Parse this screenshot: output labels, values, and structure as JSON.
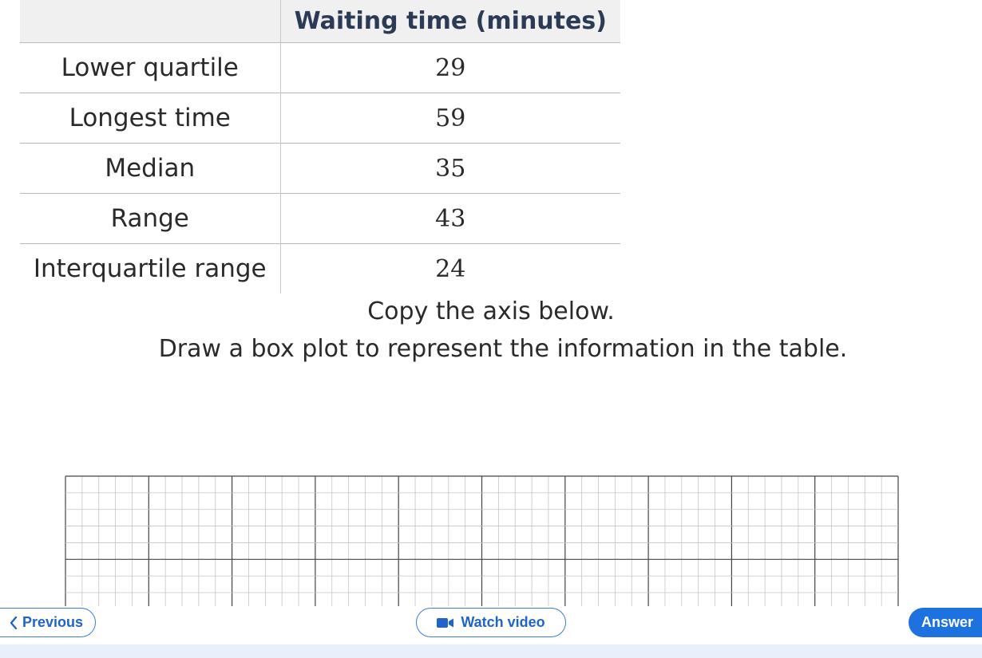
{
  "table": {
    "header": "Waiting time (minutes)",
    "rows": [
      {
        "label": "Lower quartile",
        "value": "29"
      },
      {
        "label": "Longest time",
        "value": "59"
      },
      {
        "label": "Median",
        "value": "35"
      },
      {
        "label": "Range",
        "value": "43"
      },
      {
        "label": "Interquartile range",
        "value": "24"
      }
    ]
  },
  "instructions": {
    "line1": "Copy the axis below.",
    "line2": "Draw a box plot to represent the information in the table."
  },
  "nav": {
    "previous_label": "Previous",
    "watch_video_label": "Watch video",
    "answer_label": "Answer"
  },
  "icons": {
    "previous": "chevron-left-icon",
    "watch_video": "video-camera-icon"
  },
  "colors": {
    "accent": "#1d72e0",
    "link_text": "#1f64c8",
    "header_text": "#2b3a55",
    "header_bg": "#f0f0f0"
  }
}
